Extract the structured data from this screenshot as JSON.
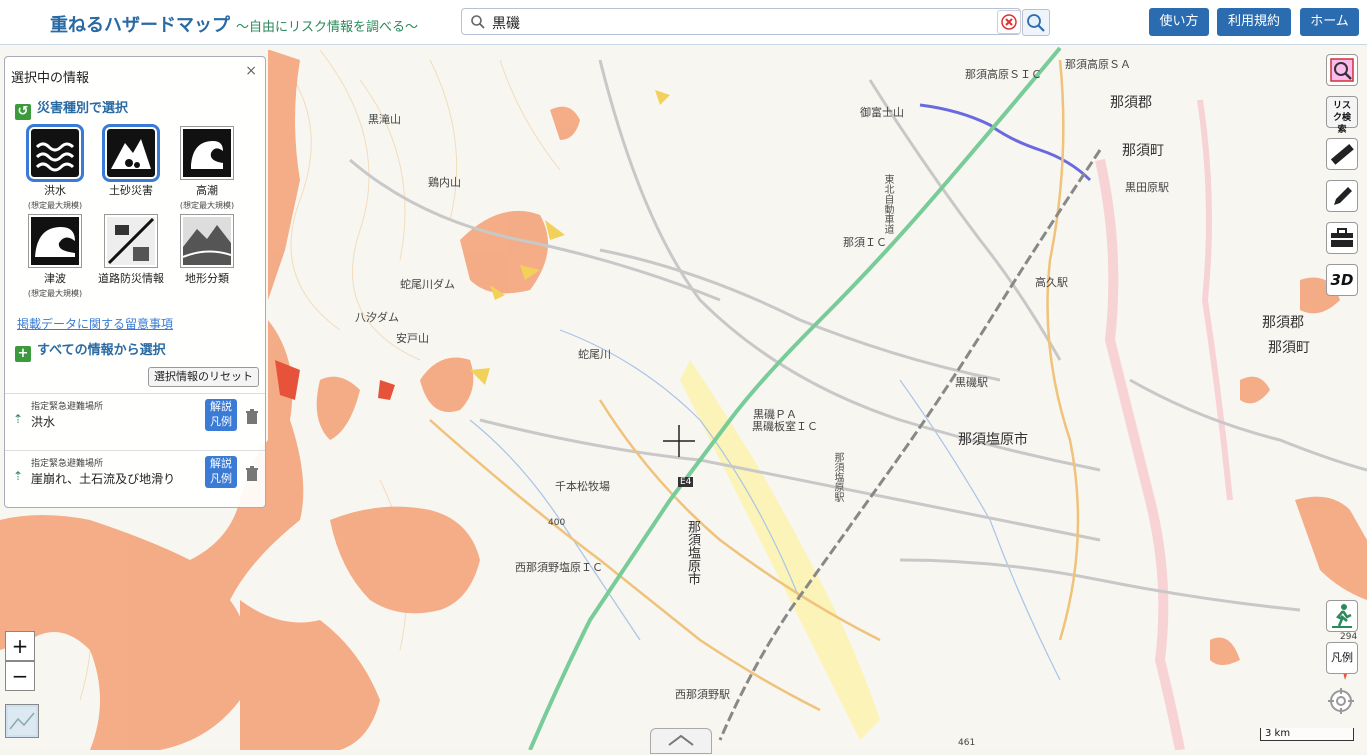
{
  "header": {
    "title": "重ねるハザードマップ",
    "subtitle": "〜自由にリスク情報を調べる〜",
    "search_value": "黒磯",
    "help_label": "使い方",
    "terms_label": "利用規約",
    "home_label": "ホーム"
  },
  "panel": {
    "title": "選択中の情報",
    "close": "×",
    "by_type_heading": "災害種別で選択",
    "hazards": [
      {
        "name": "洪水",
        "sub": "(想定最大規模)",
        "selected": true,
        "icon": "flood-icon"
      },
      {
        "name": "土砂災害",
        "sub": "",
        "selected": true,
        "icon": "landslide-icon"
      },
      {
        "name": "高潮",
        "sub": "(想定最大規模)",
        "selected": false,
        "icon": "storm-surge-icon"
      },
      {
        "name": "津波",
        "sub": "(想定最大規模)",
        "selected": false,
        "icon": "tsunami-icon"
      },
      {
        "name": "道路防災情報",
        "sub": "",
        "selected": false,
        "icon": "road-icon"
      },
      {
        "name": "地形分類",
        "sub": "",
        "selected": false,
        "icon": "terrain-icon"
      }
    ],
    "note_link": "掲載データに関する留意事項",
    "all_heading": "すべての情報から選択",
    "reset_label": "選択情報のリセット",
    "items": [
      {
        "category": "指定緊急避難場所",
        "name": "洪水",
        "legend": "解説\n凡例"
      },
      {
        "category": "指定緊急避難場所",
        "name": "崖崩れ、土石流及び地滑り",
        "legend": "解説\n凡例"
      }
    ],
    "legend_line1": "解説",
    "legend_line2": "凡例"
  },
  "tools": {
    "risk_search": "リスク検索",
    "legend": "凡例",
    "three_d": "3D"
  },
  "zoom": {
    "in": "+",
    "out": "−"
  },
  "scale_label": "3 km",
  "map_labels": {
    "nasu_gun_top": "那須郡",
    "nasu_machi": "那須町",
    "nasu_gun_right": "那須郡",
    "nasu_machi_right": "那須町",
    "nasu_shiobara_city": "那須塩原市",
    "nasu_shiobara_city_v": "那須塩原市",
    "nasu_ic": "那須ＩＣ",
    "nasu_kogen_sic": "那須高原ＳＩＣ",
    "nasu_kogen_sa": "那須高原ＳＡ",
    "kuroiso_pa": "黒磯ＰＡ",
    "kuroiso_itamuro_ic": "黒磯板室ＩＣ",
    "kuroiso_station": "黒磯駅",
    "takaku_station": "高久駅",
    "kuroda_station": "黒田原駅",
    "nishi_nasuno_ic": "西那須野塩原ＩＣ",
    "nishi_nasuno_station": "西那須野駅",
    "senbon_matsu": "千本松牧場",
    "jabigawa_dam": "蛇尾川ダム",
    "jabigawa": "蛇尾川",
    "hachiya_dam": "八汐ダム",
    "yasu_pass": "安戸山",
    "gofuji": "御富士山",
    "kurotaki": "黒滝山",
    "kamuro": "鶏内山",
    "e4": "E4",
    "r400": "400",
    "r294": "294",
    "r461": "461",
    "nasu_shiobara_eki_v": "那須塩原駅",
    "tohoku_exp": "東北自動車道"
  }
}
